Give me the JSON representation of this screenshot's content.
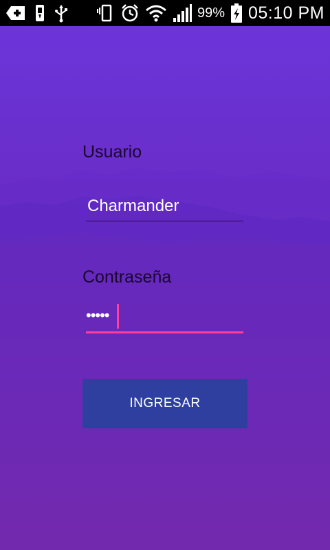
{
  "status_bar": {
    "battery_percent": "99%",
    "time": "05:10 PM",
    "icons": [
      "add-box-icon",
      "usb-storage-icon",
      "usb-icon",
      "vibrate-icon",
      "alarm-icon",
      "wifi-icon",
      "signal-icon",
      "battery-charging-icon"
    ]
  },
  "login": {
    "username_label": "Usuario",
    "username_value": "Charmander",
    "password_label": "Contraseña",
    "password_value": "•••••",
    "submit_label": "INGRESAR"
  },
  "colors": {
    "accent": "#ff3f9e",
    "button": "#2e3fa0",
    "gradient_top": "#6d35dc",
    "gradient_bottom": "#a22d86"
  }
}
